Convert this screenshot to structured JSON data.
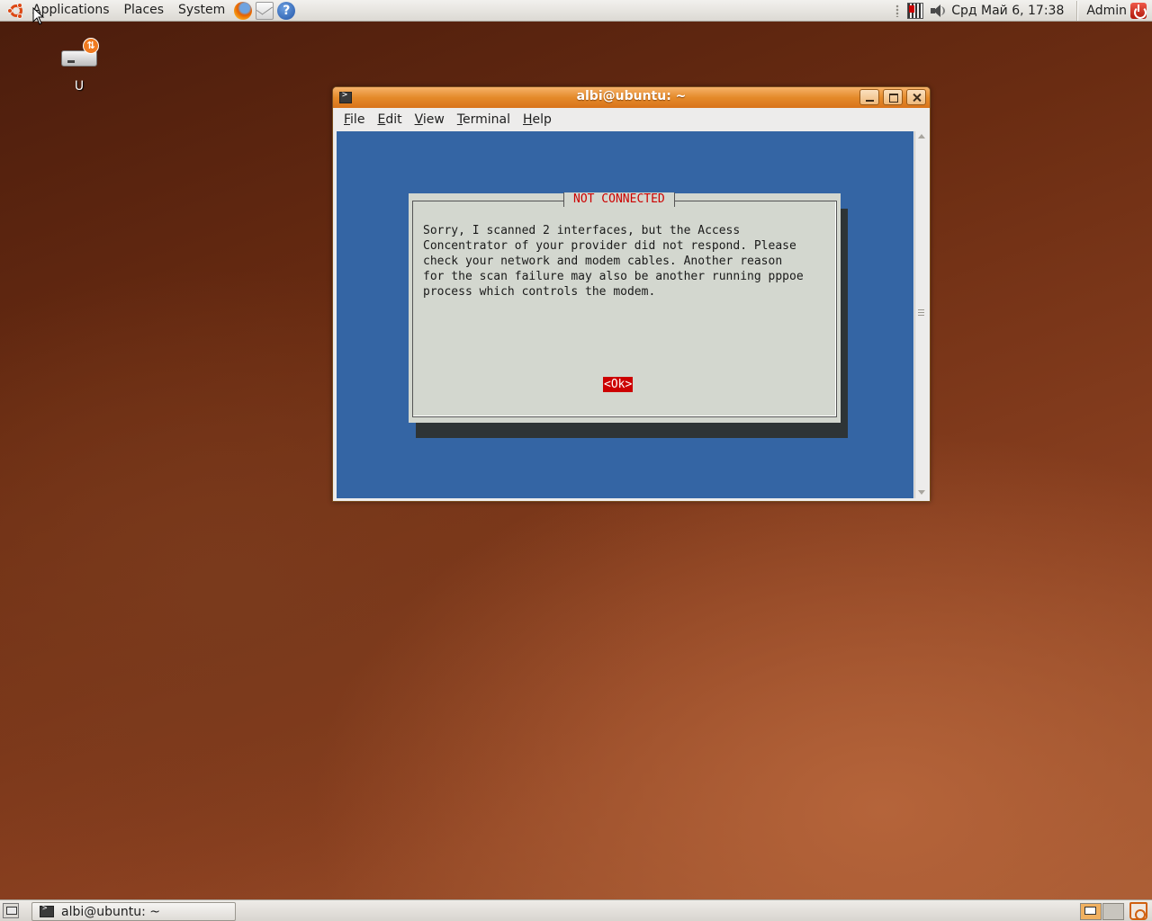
{
  "top_panel": {
    "menus": [
      "Applications",
      "Places",
      "System"
    ],
    "launchers": [
      "firefox-icon",
      "mail-icon",
      "help-icon"
    ],
    "clock": "Срд Май  6, 17:38",
    "user": "Admin"
  },
  "desktop": {
    "icons": [
      {
        "label": "U",
        "icon": "usb-drive-icon"
      }
    ]
  },
  "terminal": {
    "title": "albi@ubuntu: ~",
    "menu": [
      {
        "label": "File",
        "mnemonic": "F",
        "rest": "ile"
      },
      {
        "label": "Edit",
        "mnemonic": "E",
        "rest": "dit"
      },
      {
        "label": "View",
        "mnemonic": "V",
        "rest": "iew"
      },
      {
        "label": "Terminal",
        "mnemonic": "T",
        "rest": "erminal"
      },
      {
        "label": "Help",
        "mnemonic": "H",
        "rest": "elp"
      }
    ],
    "background_color": "#3465a4",
    "dialog": {
      "title": "NOT CONNECTED",
      "message": "Sorry, I scanned 2 interfaces, but the Access\nConcentrator of your provider did not respond. Please\ncheck your network and modem cables. Another reason\nfor the scan failure may also be another running pppoe\nprocess which controls the modem.",
      "ok_label": "<Ok>",
      "title_color": "#cc0000"
    }
  },
  "bottom_panel": {
    "task": {
      "label": "albi@ubuntu: ~"
    }
  }
}
